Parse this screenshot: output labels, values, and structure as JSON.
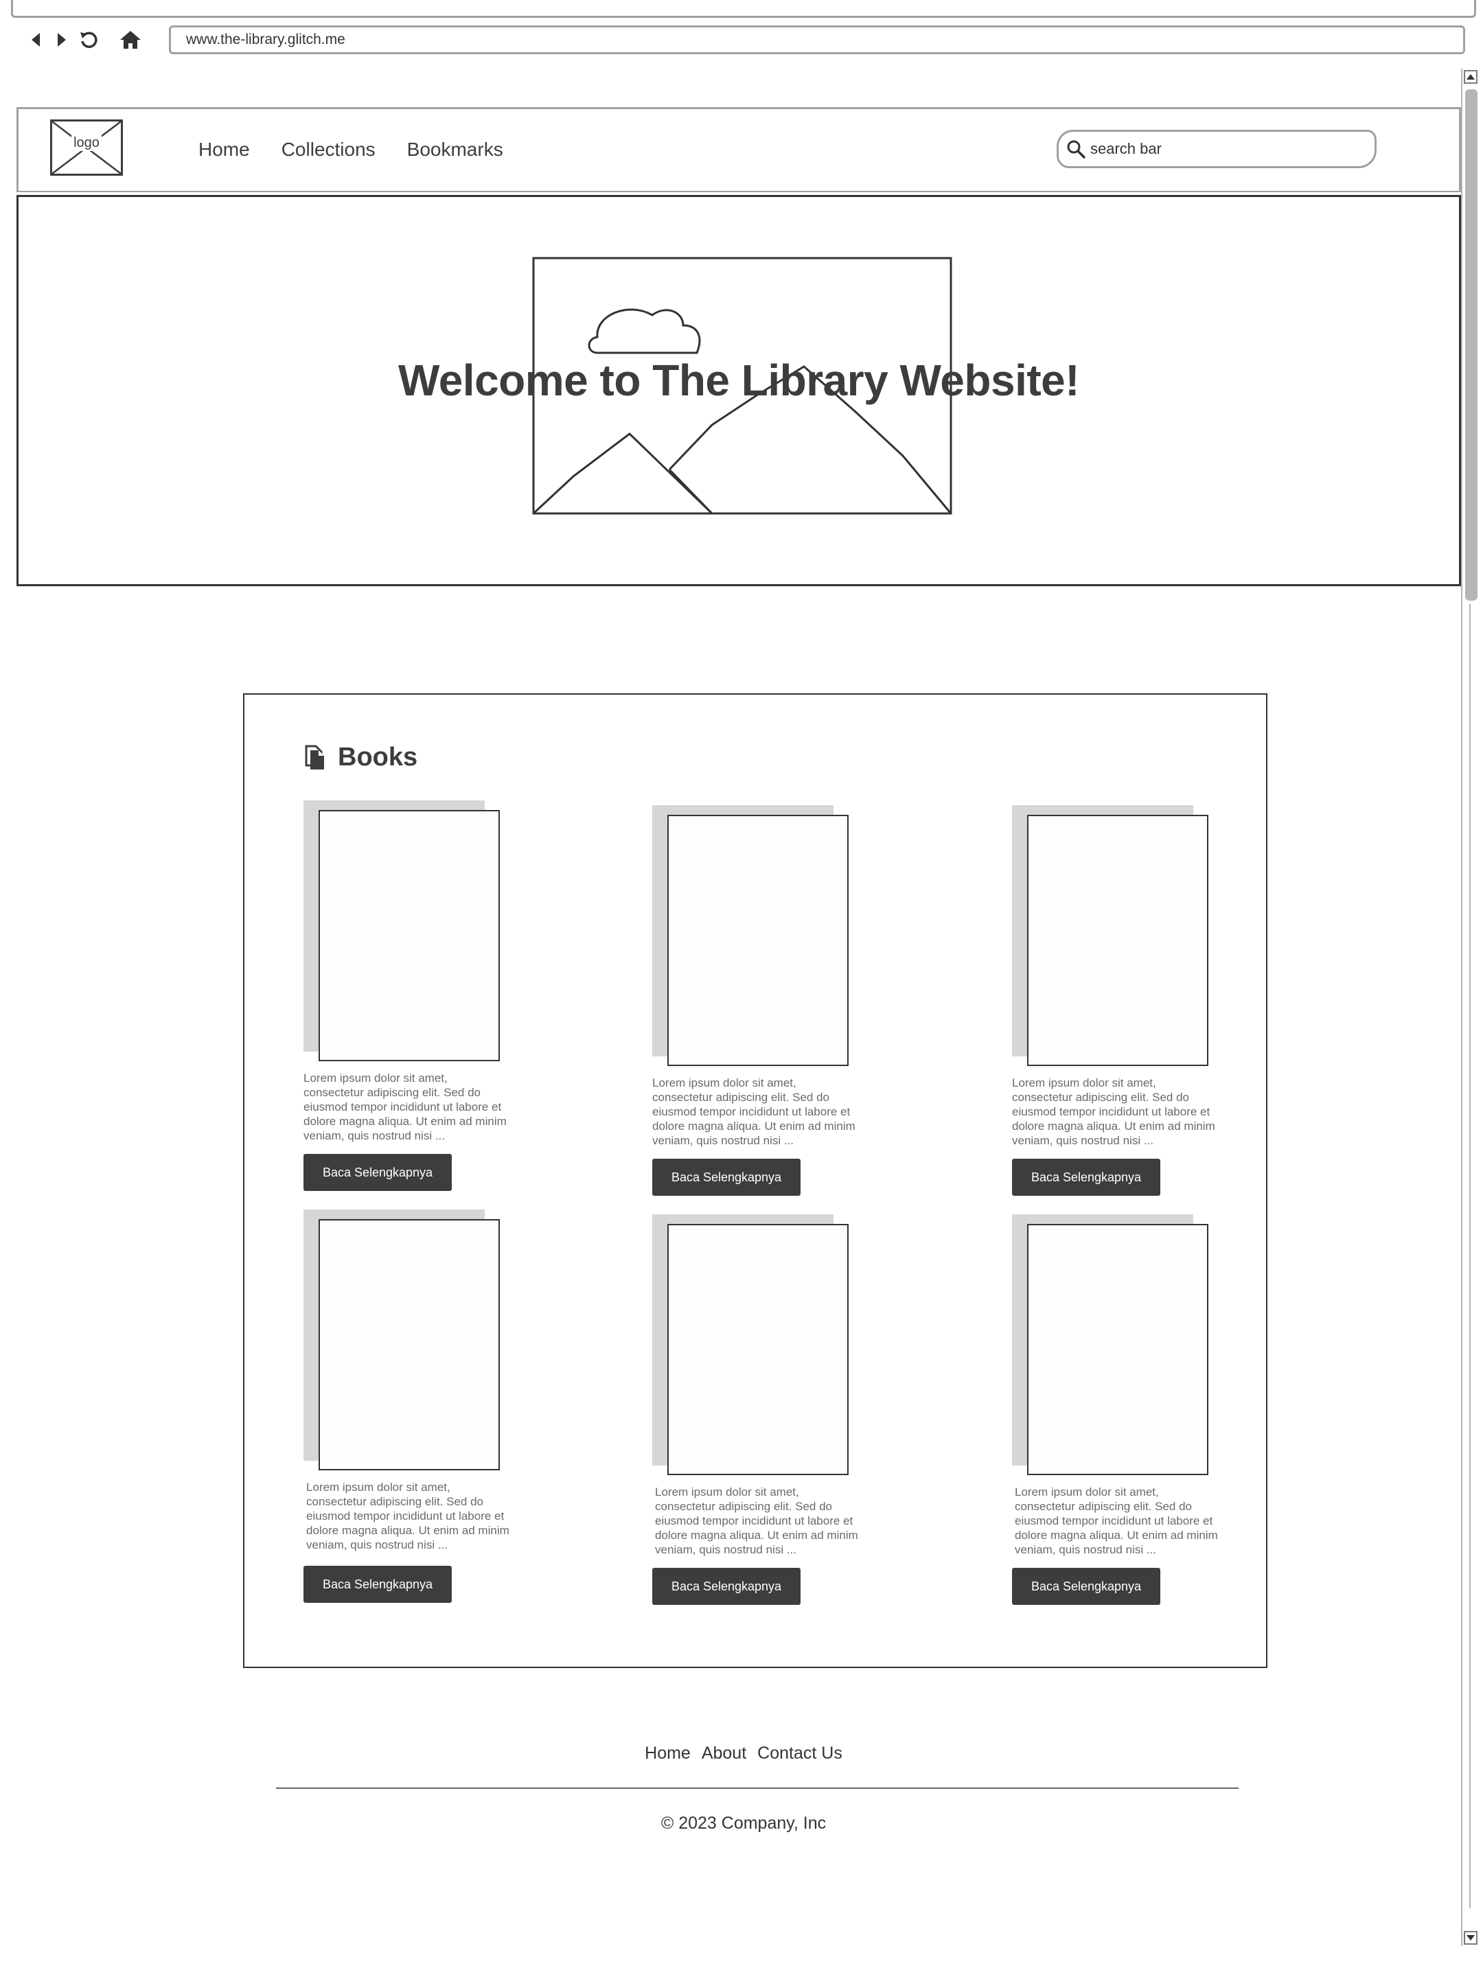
{
  "browser": {
    "url": "www.the-library.glitch.me"
  },
  "header": {
    "logo_label": "logo",
    "nav": [
      "Home",
      "Collections",
      "Bookmarks"
    ],
    "search_placeholder": "search bar"
  },
  "hero": {
    "title": "Welcome to The Library Website!"
  },
  "books": {
    "heading": "Books",
    "items": [
      {
        "description": "Lorem ipsum dolor sit amet, consectetur adipiscing elit. Sed do eiusmod tempor incididunt ut labore et dolore magna aliqua. Ut enim ad minim veniam, quis nostrud nisi ...",
        "button": "Baca Selengkapnya"
      },
      {
        "description": "Lorem ipsum dolor sit amet, consectetur adipiscing elit. Sed do eiusmod tempor incididunt ut labore et dolore magna aliqua. Ut enim ad minim veniam, quis nostrud nisi ...",
        "button": "Baca Selengkapnya"
      },
      {
        "description": "Lorem ipsum dolor sit amet, consectetur adipiscing elit. Sed do eiusmod tempor incididunt ut labore et dolore magna aliqua. Ut enim ad minim veniam, quis nostrud nisi ...",
        "button": "Baca Selengkapnya"
      },
      {
        "description": "Lorem ipsum dolor sit amet, consectetur adipiscing elit. Sed do eiusmod tempor incididunt ut labore et dolore magna aliqua. Ut enim ad minim veniam, quis nostrud nisi ...",
        "button": "Baca Selengkapnya"
      },
      {
        "description": "Lorem ipsum dolor sit amet, consectetur adipiscing elit. Sed do eiusmod tempor incididunt ut labore et dolore magna aliqua. Ut enim ad minim veniam, quis nostrud nisi ...",
        "button": "Baca Selengkapnya"
      },
      {
        "description": "Lorem ipsum dolor sit amet, consectetur adipiscing elit. Sed do eiusmod tempor incididunt ut labore et dolore magna aliqua. Ut enim ad minim veniam, quis nostrud nisi ...",
        "button": "Baca Selengkapnya"
      }
    ]
  },
  "footer": {
    "links": [
      "Home",
      "About",
      "Contact Us"
    ],
    "copyright": "© 2023 Company, Inc"
  },
  "icons": {
    "back": "back-icon",
    "forward": "forward-icon",
    "reload": "reload-icon",
    "home": "home-icon",
    "search": "search-icon",
    "books": "document-icon"
  },
  "colors": {
    "primary_dark": "#3d3d3d",
    "border_gray": "#a0a0a0",
    "cover_shadow": "#d6d6d6"
  }
}
